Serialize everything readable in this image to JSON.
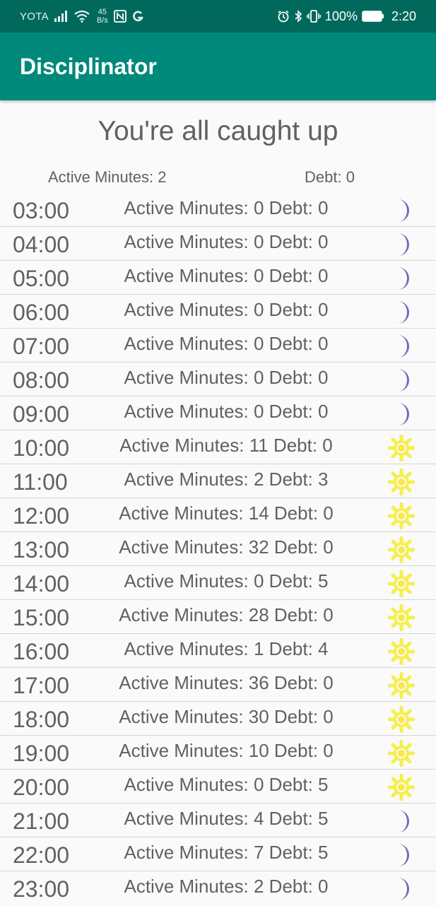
{
  "status_bar": {
    "carrier": "YOTA",
    "speed_value": "45",
    "speed_unit": "B/s",
    "battery": "100%",
    "time": "2:20"
  },
  "app_bar": {
    "title": "Disciplinator"
  },
  "header": {
    "caught_up": "You're all caught up",
    "active_minutes": "Active Minutes: 2",
    "debt": "Debt: 0"
  },
  "colors": {
    "moon": "#6b6bbf",
    "sun": "#f5ef4f",
    "sun_center": "#f7e94a",
    "appbar": "#00897b",
    "statusbar": "#00695c"
  },
  "hours": [
    {
      "time": "03:00",
      "stats": "Active Minutes: 0 Debt: 0",
      "icon": "moon-icon"
    },
    {
      "time": "04:00",
      "stats": "Active Minutes: 0 Debt: 0",
      "icon": "moon-icon"
    },
    {
      "time": "05:00",
      "stats": "Active Minutes: 0 Debt: 0",
      "icon": "moon-icon"
    },
    {
      "time": "06:00",
      "stats": "Active Minutes: 0 Debt: 0",
      "icon": "moon-icon"
    },
    {
      "time": "07:00",
      "stats": "Active Minutes: 0 Debt: 0",
      "icon": "moon-icon"
    },
    {
      "time": "08:00",
      "stats": "Active Minutes: 0 Debt: 0",
      "icon": "moon-icon"
    },
    {
      "time": "09:00",
      "stats": "Active Minutes: 0 Debt: 0",
      "icon": "moon-icon"
    },
    {
      "time": "10:00",
      "stats": "Active Minutes: 11 Debt: 0",
      "icon": "sun-icon"
    },
    {
      "time": "11:00",
      "stats": "Active Minutes: 2 Debt: 3",
      "icon": "sun-icon"
    },
    {
      "time": "12:00",
      "stats": "Active Minutes: 14 Debt: 0",
      "icon": "sun-icon"
    },
    {
      "time": "13:00",
      "stats": "Active Minutes: 32 Debt: 0",
      "icon": "sun-icon"
    },
    {
      "time": "14:00",
      "stats": "Active Minutes: 0 Debt: 5",
      "icon": "sun-icon"
    },
    {
      "time": "15:00",
      "stats": "Active Minutes: 28 Debt: 0",
      "icon": "sun-icon"
    },
    {
      "time": "16:00",
      "stats": "Active Minutes: 1 Debt: 4",
      "icon": "sun-icon"
    },
    {
      "time": "17:00",
      "stats": "Active Minutes: 36 Debt: 0",
      "icon": "sun-icon"
    },
    {
      "time": "18:00",
      "stats": "Active Minutes: 30 Debt: 0",
      "icon": "sun-icon"
    },
    {
      "time": "19:00",
      "stats": "Active Minutes: 10 Debt: 0",
      "icon": "sun-icon"
    },
    {
      "time": "20:00",
      "stats": "Active Minutes: 0 Debt: 5",
      "icon": "sun-icon"
    },
    {
      "time": "21:00",
      "stats": "Active Minutes: 4 Debt: 5",
      "icon": "moon-icon"
    },
    {
      "time": "22:00",
      "stats": "Active Minutes: 7 Debt: 5",
      "icon": "moon-icon"
    },
    {
      "time": "23:00",
      "stats": "Active Minutes: 2 Debt: 0",
      "icon": "moon-icon"
    }
  ]
}
